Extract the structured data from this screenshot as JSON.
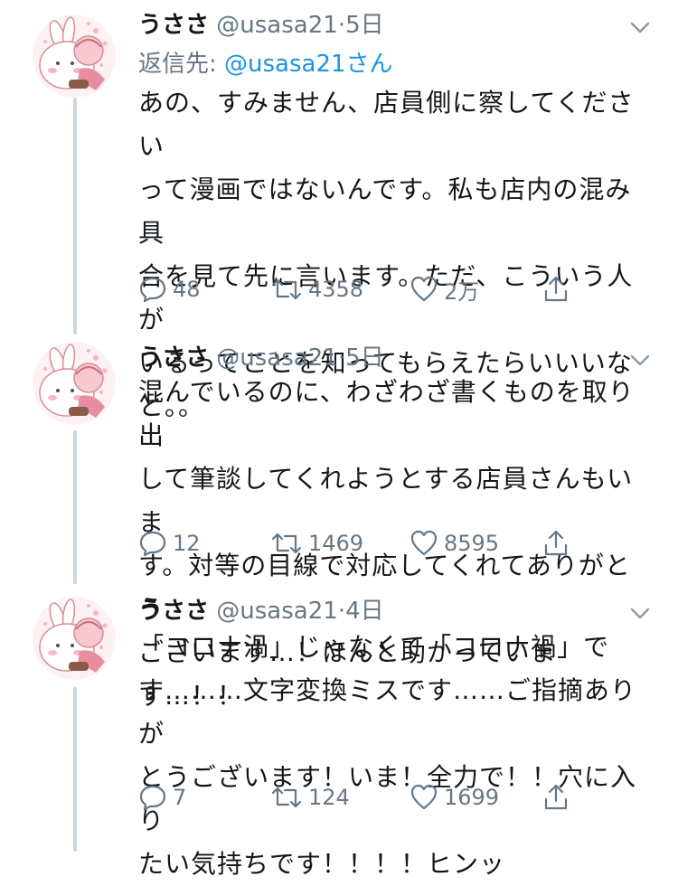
{
  "tweets": [
    {
      "name": "うささ",
      "handle": "@usasa21",
      "separator": "·",
      "time": "5日",
      "reply_prefix": "返信先:",
      "reply_mention": "@usasa21さん",
      "lines": [
        "あの、すみません、店員側に察してください",
        "って漫画ではないんです。私も店内の混み具",
        "合を見て先に言います。ただ、こういう人が",
        "いるってことを知ってもらえたらいいいな",
        "と。。"
      ],
      "replies": "48",
      "retweets": "4358",
      "likes": "2万"
    },
    {
      "name": "うささ",
      "handle": "@usasa21",
      "separator": "·",
      "time": "5日",
      "lines": [
        "混んでいるのに、わざわざ書くものを取り出",
        "して筆談してくれようとする店員さんもいま",
        "す。対等の目線で対応してくれてありがとう",
        "ございます…！ほんと助かっています…！！"
      ],
      "replies": "12",
      "retweets": "1469",
      "likes": "8595"
    },
    {
      "name": "うささ",
      "handle": "@usasa21",
      "separator": "·",
      "time": "4日",
      "lines": [
        "「コロナ渦」じゃなくて「コロナ禍」で",
        "す………文字変換ミスです……ご指摘ありが",
        "とうございます！いま！全力で！！穴に入り",
        "たい気持ちです！！！！ヒンッ"
      ],
      "replies": "7",
      "retweets": "124",
      "likes": "1699"
    }
  ],
  "icons": {
    "reply": "speech-bubble-icon",
    "retweet": "retweet-arrows-icon",
    "like": "heart-icon",
    "share": "share-upload-icon",
    "menu": "chevron-down-icon"
  },
  "colors": {
    "text": "#14171a",
    "secondary": "#657786",
    "link": "#1b95e0",
    "thread_line": "#ccd6dd",
    "avatar_pink": "#f3a7b6"
  }
}
